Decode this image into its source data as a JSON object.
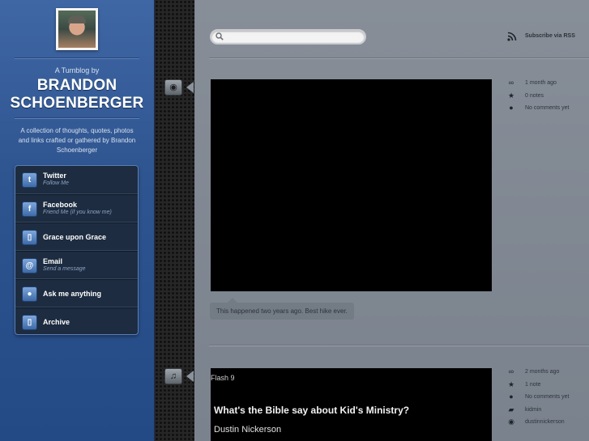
{
  "sidebar": {
    "avatar_alt": "Profile photo",
    "tumblog_by": "A Tumblog by",
    "name_line1": "BRANDON",
    "name_line2": "SCHOENBERGER",
    "tagline": "A collection of thoughts, quotes, photos and links crafted or gathered by Brandon Schoenberger",
    "links": [
      {
        "title": "Twitter",
        "sub": "Follow Me",
        "icon": "twitter-icon",
        "glyph": "t"
      },
      {
        "title": "Facebook",
        "sub": "Friend Me (if you know me)",
        "icon": "facebook-icon",
        "glyph": "f"
      },
      {
        "title": "Grace upon Grace",
        "sub": "",
        "icon": "page-icon",
        "glyph": "▯"
      },
      {
        "title": "Email",
        "sub": "Send a message",
        "icon": "email-icon",
        "glyph": "@"
      },
      {
        "title": "Ask me anything",
        "sub": "",
        "icon": "speech-bubble-icon",
        "glyph": "●"
      },
      {
        "title": "Archive",
        "sub": "",
        "icon": "page-icon",
        "glyph": "▯"
      }
    ]
  },
  "header": {
    "search_placeholder": "",
    "subscribe_label": "Subscribe via RSS"
  },
  "posts": [
    {
      "type_icon": "video-camera-icon",
      "caption": "This happened two years ago. Best hike ever.",
      "meta": [
        {
          "icon": "link-icon",
          "glyph": "∞",
          "text": "1 month ago"
        },
        {
          "icon": "star-icon",
          "glyph": "★",
          "text": "0 notes"
        },
        {
          "icon": "comment-icon",
          "glyph": "●",
          "text": "No comments yet"
        }
      ]
    },
    {
      "type_icon": "speaker-icon",
      "flash_label": "Flash 9",
      "title": "What's the Bible say about Kid's Ministry?",
      "author": "Dustin Nickerson",
      "meta": [
        {
          "icon": "link-icon",
          "glyph": "∞",
          "text": "2 months ago"
        },
        {
          "icon": "star-icon",
          "glyph": "★",
          "text": "1 note"
        },
        {
          "icon": "comment-icon",
          "glyph": "●",
          "text": "No comments yet"
        },
        {
          "icon": "tag-icon",
          "glyph": "▰",
          "text": "kidmin"
        },
        {
          "icon": "reblog-icon",
          "glyph": "◉",
          "text": "dustinnickerson"
        }
      ]
    }
  ]
}
